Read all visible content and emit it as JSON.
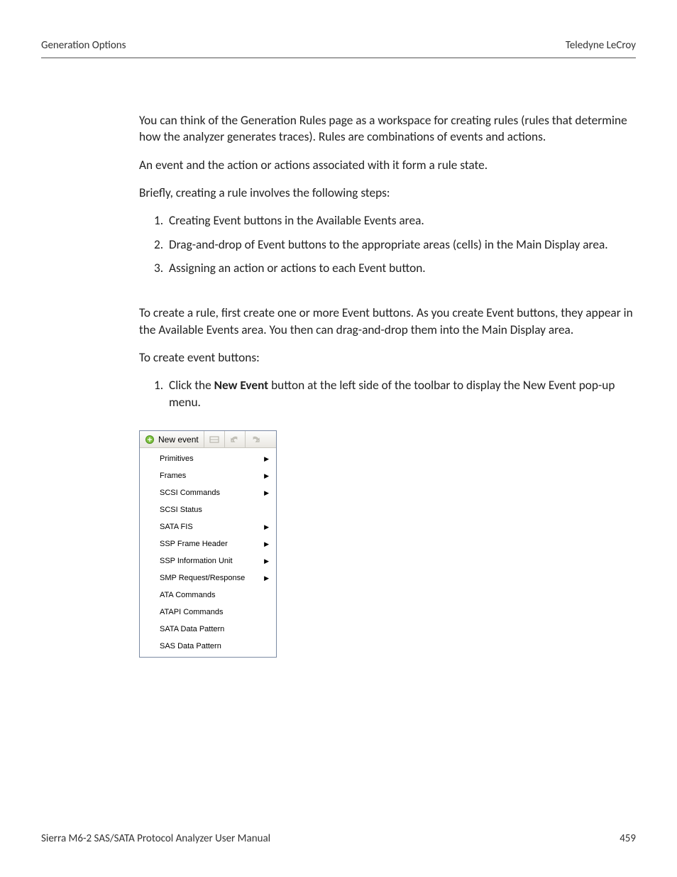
{
  "header": {
    "left": "Generation Options",
    "right": "Teledyne LeCroy"
  },
  "body": {
    "p1": "You can think of the Generation Rules page as a workspace for creating rules (rules that determine how the analyzer generates traces). Rules are combinations of events and actions.",
    "p2": "An event and the action or actions associated with it form a rule state.",
    "p3": "Briefly, creating a rule involves the following steps:",
    "steps": [
      "Creating Event buttons in the Available Events area.",
      "Drag-and-drop of Event buttons to the appropriate areas (cells) in the Main Display area.",
      "Assigning an action or actions to each Event button."
    ],
    "p4": "To create a rule, first create one or more Event buttons. As you create Event buttons, they appear in the Available Events area. You then can drag-and-drop them into the Main Display area.",
    "p5": "To create event buttons:",
    "instr1_a": "Click the ",
    "instr1_bold": "New Event",
    "instr1_b": " button at the left side of the toolbar to display the New Event pop-up menu."
  },
  "popup": {
    "toolbar": {
      "new_event": "New event"
    },
    "items": [
      {
        "label": "Primitives",
        "submenu": true
      },
      {
        "label": "Frames",
        "submenu": true
      },
      {
        "label": "SCSI Commands",
        "submenu": true
      },
      {
        "label": "SCSI Status",
        "submenu": false
      },
      {
        "label": "SATA FIS",
        "submenu": true
      },
      {
        "label": "SSP Frame Header",
        "submenu": true
      },
      {
        "label": "SSP Information Unit",
        "submenu": true
      },
      {
        "label": "SMP Request/Response",
        "submenu": true
      },
      {
        "label": "ATA Commands",
        "submenu": false
      },
      {
        "label": "ATAPI Commands",
        "submenu": false
      },
      {
        "label": "SATA Data Pattern",
        "submenu": false
      },
      {
        "label": "SAS Data Pattern",
        "submenu": false
      }
    ]
  },
  "footer": {
    "left": "Sierra M6-2 SAS/SATA Protocol Analyzer User Manual",
    "right": "459"
  }
}
